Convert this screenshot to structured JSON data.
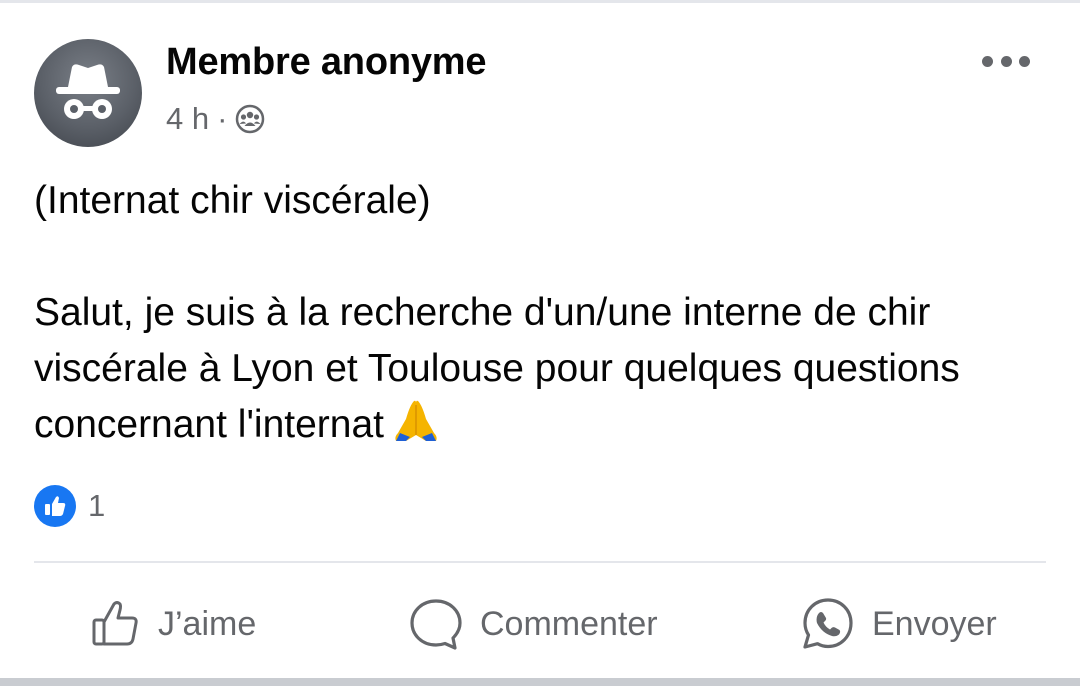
{
  "post": {
    "author": "Membre anonyme",
    "time": "4 h",
    "separator": "·",
    "audience_icon": "group-icon",
    "avatar_icon": "incognito-icon",
    "more_icon": "more-horizontal-icon",
    "text_line1": "(Internat chir viscérale)",
    "text_line2": "Salut, je suis à la recherche d'un/une interne de chir viscérale à Lyon et Toulouse pour quelques questions concernant l'internat",
    "emoji": "pray-emoji"
  },
  "reactions": {
    "icon": "like-badge-icon",
    "count": "1"
  },
  "actions": {
    "like_label": "J’aime",
    "comment_label": "Commenter",
    "send_label": "Envoyer"
  },
  "colors": {
    "secondary_text": "#65676b",
    "like_blue": "#1877f2",
    "divider": "#e4e6eb"
  }
}
